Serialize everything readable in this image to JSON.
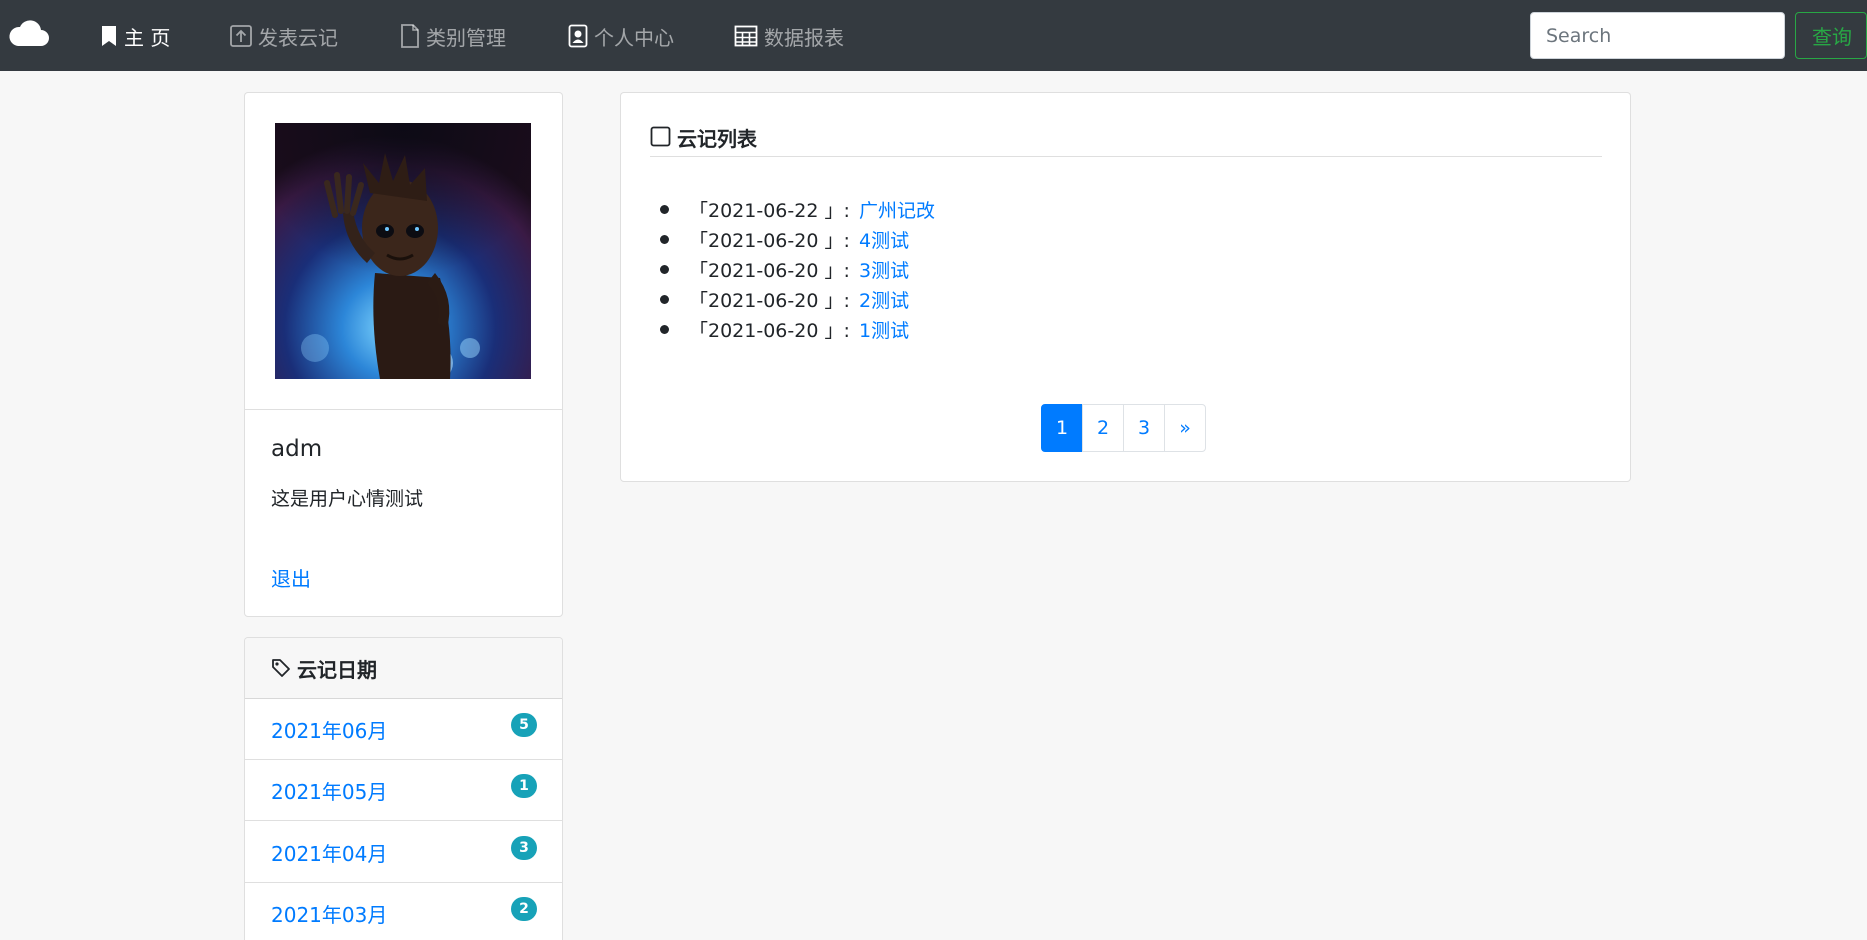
{
  "navbar": {
    "items": [
      {
        "label": "主 页",
        "icon": "bookmark-icon",
        "active": true
      },
      {
        "label": "发表云记",
        "icon": "upload-icon",
        "active": false
      },
      {
        "label": "类别管理",
        "icon": "file-icon",
        "active": false
      },
      {
        "label": "个人中心",
        "icon": "person-badge-icon",
        "active": false
      },
      {
        "label": "数据报表",
        "icon": "table-icon",
        "active": false
      }
    ],
    "search_placeholder": "Search",
    "search_button": "查询"
  },
  "profile": {
    "username": "adm",
    "mood": "这是用户心情测试",
    "logout": "退出"
  },
  "dates": {
    "title": "云记日期",
    "items": [
      {
        "label": "2021年06月",
        "count": "5"
      },
      {
        "label": "2021年05月",
        "count": "1"
      },
      {
        "label": "2021年04月",
        "count": "3"
      },
      {
        "label": "2021年03月",
        "count": "2"
      }
    ]
  },
  "notes": {
    "title": "云记列表",
    "items": [
      {
        "date": "「2021-06-22 」:",
        "title": "广州记改"
      },
      {
        "date": "「2021-06-20 」:",
        "title": "4测试"
      },
      {
        "date": "「2021-06-20 」:",
        "title": "3测试"
      },
      {
        "date": "「2021-06-20 」:",
        "title": "2测试"
      },
      {
        "date": "「2021-06-20 」:",
        "title": "1测试"
      }
    ]
  },
  "pagination": {
    "pages": [
      "1",
      "2",
      "3",
      "»"
    ],
    "active": "1"
  },
  "colors": {
    "navbar": "#343a40",
    "link": "#007bff",
    "badge": "#17a2b8",
    "success": "#28a745"
  }
}
